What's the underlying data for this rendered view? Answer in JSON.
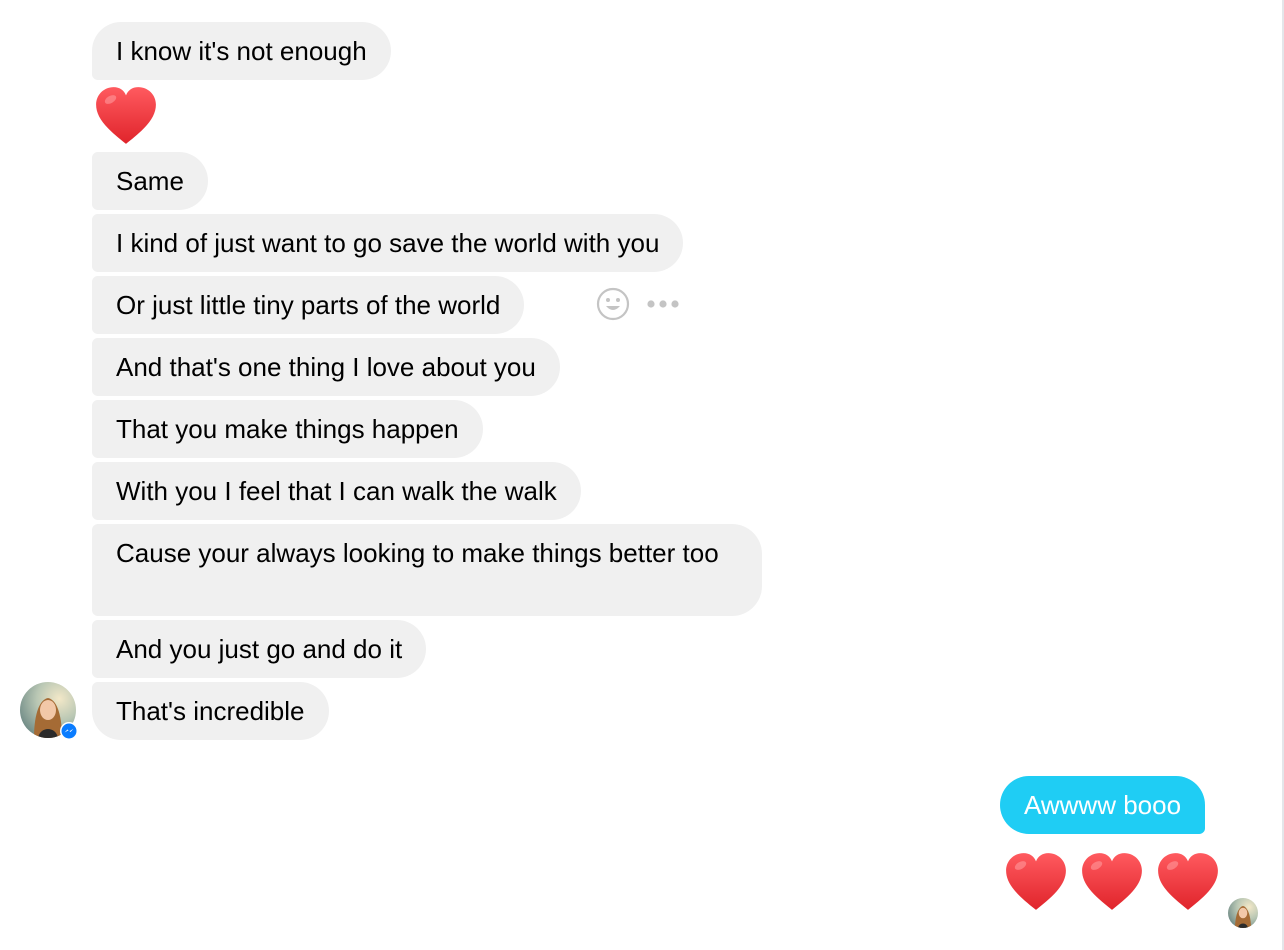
{
  "colors": {
    "incoming_bubble": "#f0f0f0",
    "outgoing_bubble": "#1fcdf4",
    "heart": "#f1353a"
  },
  "incoming": {
    "msg1": "I know it's not enough",
    "msg3": "Same",
    "msg4": "I kind of just want to go save the world with you",
    "msg5": "Or just little tiny parts of the world",
    "msg6": "And that's one thing I love about you",
    "msg7": "That you make things happen",
    "msg8": "With you I feel that I can walk the walk",
    "msg9": "Cause your always looking to make things better too",
    "msg10": "And you just go and do it",
    "msg11": "That's incredible"
  },
  "outgoing": {
    "msg1": "Awwww booo"
  },
  "icons": {
    "reaction": "smile-icon",
    "more": "more-options-icon",
    "badge": "messenger-badge-icon",
    "heart": "heart-icon"
  }
}
